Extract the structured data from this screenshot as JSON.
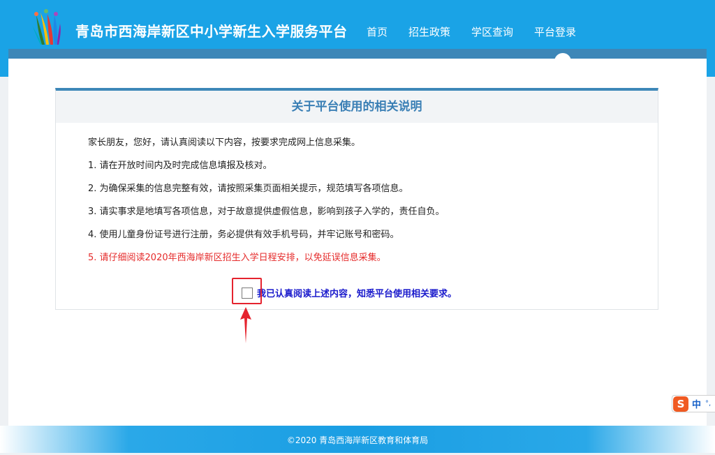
{
  "header": {
    "title": "青岛市西海岸新区中小学新生入学服务平台",
    "nav": [
      {
        "label": "首页"
      },
      {
        "label": "招生政策"
      },
      {
        "label": "学区查询"
      },
      {
        "label": "平台登录"
      }
    ],
    "active_nav": "平台登录"
  },
  "notice": {
    "title": "关于平台使用的相关说明",
    "lines": [
      "家长朋友，您好，请认真阅读以下内容，按要求完成网上信息采集。",
      "1. 请在开放时间内及时完成信息填报及核对。",
      "2. 为确保采集的信息完整有效，请按照采集页面相关提示，规范填写各项信息。",
      "3. 请实事求是地填写各项信息，对于故意提供虚假信息，影响到孩子入学的，责任自负。",
      "4. 使用儿童身份证号进行注册，务必提供有效手机号码，并牢记账号和密码。",
      "5. 请仔细阅读2020年西海岸新区招生入学日程安排，以免延误信息采集。"
    ],
    "agree_label": "我已认真阅读上述内容，知悉平台使用相关要求。",
    "agree_checked": false
  },
  "footer": {
    "copyright": "©2020 青岛西海岸新区教育和体育局"
  },
  "ime": {
    "logo": "S",
    "mode": "中",
    "punct": "°,"
  },
  "colors": {
    "header_bg": "#1aa3e6",
    "accent": "#3d87b8",
    "notice_title": "#3a7fb5",
    "warning_text": "#e52b2b",
    "agree_text": "#1a1acc",
    "highlight": "#e5232e"
  }
}
